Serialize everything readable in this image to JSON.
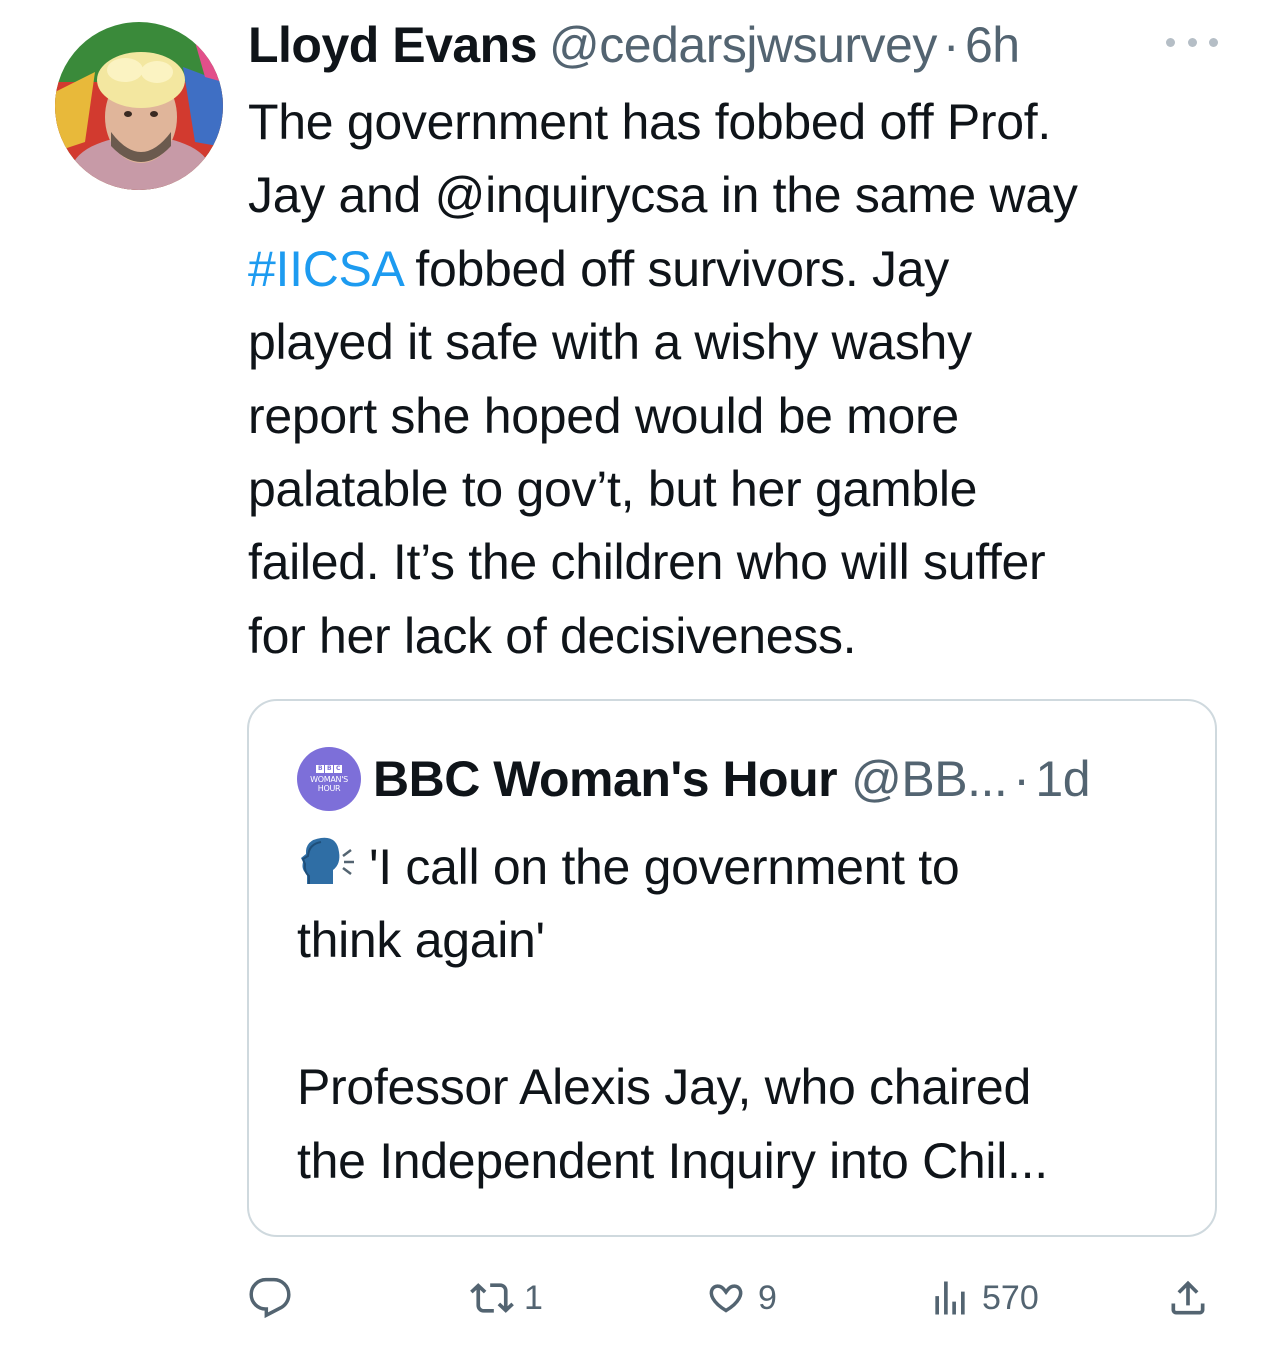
{
  "tweet": {
    "author_name": "Lloyd Evans",
    "author_handle": "@cedarsjwsurvey",
    "separator": "·",
    "timestamp": "6h",
    "more_icon": "more-horizontal-icon",
    "text_lines": [
      "The government has fobbed off Prof.",
      "Jay and @inquirycsa in the same way",
      " fobbed off survivors. Jay",
      "played it safe with a wishy washy",
      "report she hoped would be more",
      "palatable to gov’t, but her gamble",
      "failed. It’s the children who will suffer",
      "for her lack of decisiveness."
    ],
    "hashtag": "#IICSA",
    "hashtag_color": "#1d9bf0"
  },
  "quoted_tweet": {
    "avatar_bbc": [
      "B",
      "B",
      "C"
    ],
    "avatar_text_1": "WOMAN'S",
    "avatar_text_2": "HOUR",
    "author_name": "BBC Woman's Hour",
    "author_handle": "@BB...",
    "separator": "·",
    "timestamp": "1d",
    "emoji_icon": "speaking-head-icon",
    "text_lines": [
      "'I call on the government to",
      "think again'",
      "Professor Alexis Jay, who chaired",
      "the Independent Inquiry into Chil..."
    ]
  },
  "actions": {
    "reply_icon": "reply-icon",
    "retweet_icon": "retweet-icon",
    "retweet_count": "1",
    "like_icon": "heart-icon",
    "like_count": "9",
    "views_icon": "views-icon",
    "views_count": "570",
    "share_icon": "share-icon",
    "icon_color": "#536471"
  }
}
